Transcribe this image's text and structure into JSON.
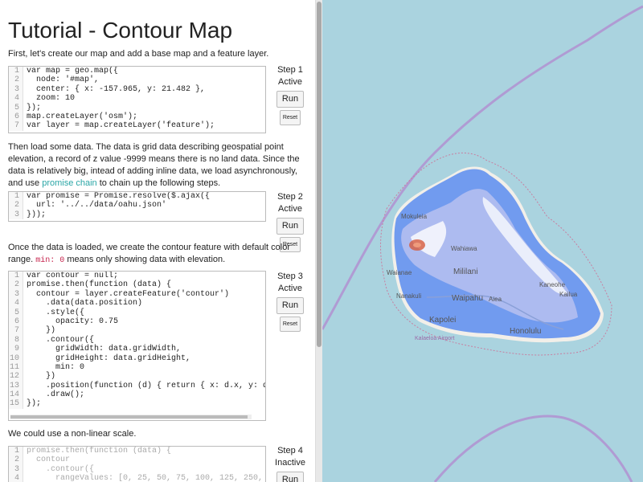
{
  "title": "Tutorial - Contour Map",
  "paragraphs": {
    "p1": "First, let's create our map and add a base map and a feature layer.",
    "p2_a": "Then load some data. The data is grid data describing geospatial point elevation, a record of z value -9999 means there is no land data. Since the data is relatively big, intead of adding inline data, we load asynchronously, and use ",
    "p2_link": "promise chain",
    "p2_b": " to chain up the following steps.",
    "p3_a": "Once the data is loaded, we create the contour feature with default color range. ",
    "p3_code": "min: 0",
    "p3_b": " means only showing data with elevation.",
    "p4": "We could use a non-linear scale."
  },
  "steps": [
    {
      "label": "Step 1",
      "status": "Active",
      "run": "Run",
      "reset": "Reset"
    },
    {
      "label": "Step 2",
      "status": "Active",
      "run": "Run",
      "reset": "Reset"
    },
    {
      "label": "Step 3",
      "status": "Active",
      "run": "Run",
      "reset": "Reset"
    },
    {
      "label": "Step 4",
      "status": "Inactive",
      "run": "Run"
    }
  ],
  "code": {
    "block1": [
      "var map = geo.map({",
      "  node: '#map',",
      "  center: { x: -157.965, y: 21.482 },",
      "  zoom: 10",
      "});",
      "map.createLayer('osm');",
      "var layer = map.createLayer('feature');"
    ],
    "block2": [
      "var promise = Promise.resolve($.ajax({",
      "  url: '../../data/oahu.json'",
      "}));"
    ],
    "block3": [
      "var contour = null;",
      "promise.then(function (data) {",
      "  contour = layer.createFeature('contour')",
      "    .data(data.position)",
      "    .style({",
      "      opacity: 0.75",
      "    })",
      "    .contour({",
      "      gridWidth: data.gridWidth,",
      "      gridHeight: data.gridHeight,",
      "      min: 0",
      "    })",
      "    .position(function (d) { return { x: d.x, y: d.y, z",
      "    .draw();",
      "});"
    ],
    "block4": [
      "promise.then(function (data) {",
      "  contour",
      "    .contour({",
      "      rangeValues: [0, 25, 50, 75, 100, 125, 250, 500,"
    ]
  },
  "map_labels": {
    "mokuleia": "Mokuleia",
    "wahiawa": "Wahiawa",
    "waianae": "Waianae",
    "mililani": "Mililani",
    "nanakuli": "Nanakuli",
    "waipahu": "Waipahu",
    "aiea": "Aiea",
    "kaneohe": "Kaneohe",
    "kailua": "Kailua",
    "kapolei": "Kapolei",
    "honolulu": "Honolulu",
    "kalaeloa": "Kalaeloa Airport"
  },
  "colors": {
    "ocean": "#aad3df",
    "land": "#f2efe9",
    "contour_low": "#5b8cf0",
    "contour_mid": "#b4bff0",
    "contour_high": "#d65b3c",
    "boundary": "#b09bd3"
  }
}
